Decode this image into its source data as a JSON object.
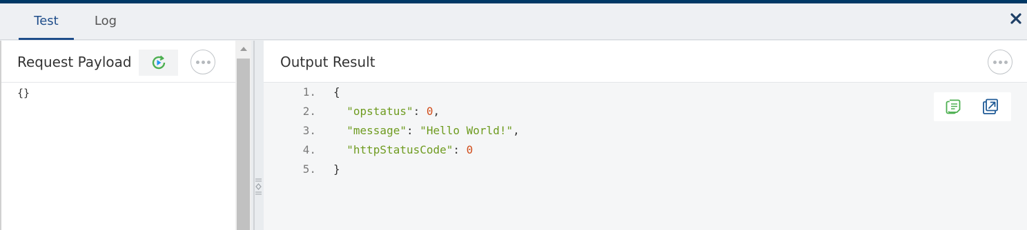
{
  "tabs": [
    {
      "label": "Test",
      "active": true
    },
    {
      "label": "Log",
      "active": false
    }
  ],
  "icons": {
    "close": "close-icon",
    "run": "run-refresh-icon",
    "more": "more-options-icon",
    "copy": "copy-icon",
    "popout": "popout-icon"
  },
  "colors": {
    "accent": "#003865",
    "active_tab": "#1e4d8a",
    "run_icon": "#4caf50",
    "json_key": "#6e9b1f",
    "json_number": "#d14e1c"
  },
  "request_panel": {
    "title": "Request Payload",
    "payload": "{}"
  },
  "output_panel": {
    "title": "Output Result",
    "lines": [
      {
        "number": "1.",
        "parts": [
          {
            "text": "{",
            "type": "punct"
          }
        ]
      },
      {
        "number": "2.",
        "parts": [
          {
            "text": "  \"opstatus\"",
            "type": "key"
          },
          {
            "text": ": ",
            "type": "punct"
          },
          {
            "text": "0",
            "type": "num"
          },
          {
            "text": ",",
            "type": "punct"
          }
        ]
      },
      {
        "number": "3.",
        "parts": [
          {
            "text": "  \"message\"",
            "type": "key"
          },
          {
            "text": ": ",
            "type": "punct"
          },
          {
            "text": "\"Hello World!\"",
            "type": "str"
          },
          {
            "text": ",",
            "type": "punct"
          }
        ]
      },
      {
        "number": "4.",
        "parts": [
          {
            "text": "  \"httpStatusCode\"",
            "type": "key"
          },
          {
            "text": ": ",
            "type": "punct"
          },
          {
            "text": "0",
            "type": "num"
          }
        ]
      },
      {
        "number": "5.",
        "parts": [
          {
            "text": "}",
            "type": "punct"
          }
        ]
      }
    ]
  }
}
